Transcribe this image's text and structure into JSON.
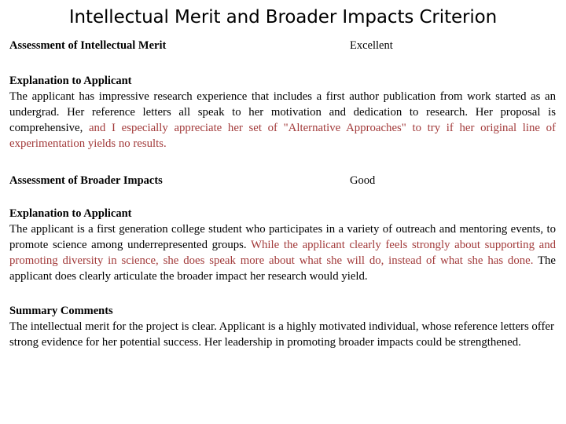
{
  "document": {
    "title": "Intellectual Merit and Broader Impacts Criterion",
    "accent_red": "#A23A3A",
    "text_color": "#000000",
    "background": "#FFFFFF"
  },
  "intellectual_merit": {
    "assessment_label": "Assessment of Intellectual Merit",
    "assessment_value": "Excellent",
    "explanation_heading": "Explanation to Applicant",
    "explanation_black_1": "The applicant has impressive research experience that includes a first author publication from work started as an undergrad. Her reference letters all speak to her motivation and dedication to research. Her proposal is comprehensive,",
    "explanation_red": " and I especially appreciate her set of \"Alternative Approaches\" to try if her original line of experimentation yields no results.",
    "explanation_black_2": ""
  },
  "broader_impacts": {
    "assessment_label": "Assessment of Broader Impacts",
    "assessment_value": "Good",
    "explanation_heading": "Explanation to Applicant",
    "explanation_black_1": "The applicant is a first generation college student who participates in a variety of outreach and mentoring events, to promote science among underrepresented groups.",
    "explanation_red": " While the applicant clearly feels strongly about supporting and promoting diversity in science, she does speak more about what she will do, instead of what she has done.",
    "explanation_black_2": " The applicant does clearly articulate the broader impact her research would yield."
  },
  "summary": {
    "heading": "Summary Comments",
    "text": "The intellectual merit for the project is clear. Applicant is a highly motivated individual, whose reference letters offer strong evidence for her potential success. Her leadership in promoting broader impacts could be strengthened."
  }
}
